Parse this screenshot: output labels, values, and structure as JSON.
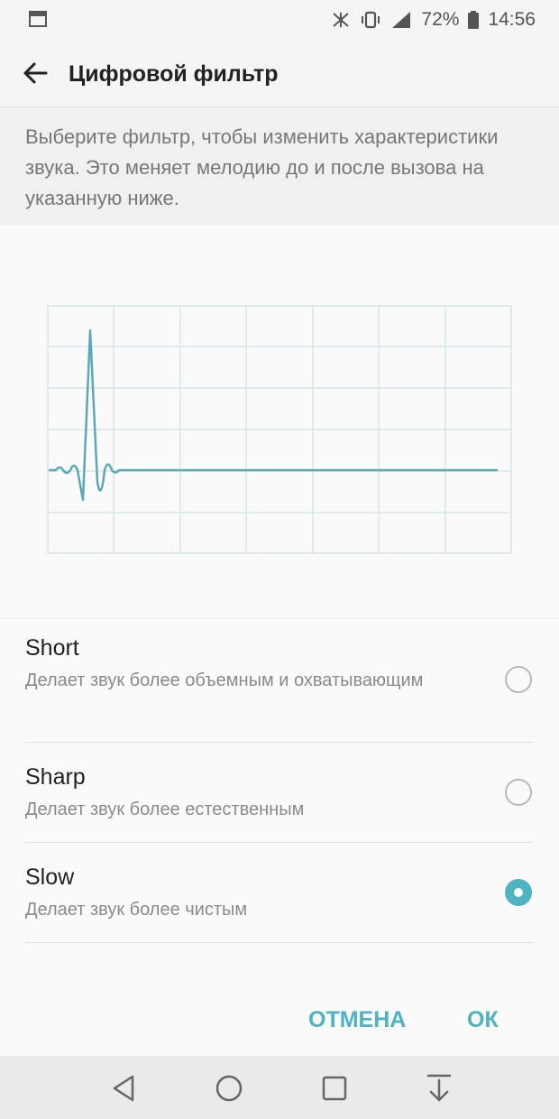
{
  "status_bar": {
    "battery_percent": "72%",
    "time": "14:56"
  },
  "app_bar": {
    "title": "Цифровой фильтр"
  },
  "description": "Выберите фильтр, чтобы изменить характеристики звука. Это меняет мелодию до и после вызова на указанную ниже.",
  "options": [
    {
      "title": "Short",
      "description": "Делает звук более объемным и охватывающим",
      "selected": false
    },
    {
      "title": "Sharp",
      "description": "Делает звук более естественным",
      "selected": false
    },
    {
      "title": "Slow",
      "description": "Делает звук более чистым",
      "selected": true
    }
  ],
  "buttons": {
    "cancel": "ОТМЕНА",
    "ok": "ОК"
  },
  "colors": {
    "accent": "#4fb3c1",
    "waveform": "#5aa9b5"
  }
}
